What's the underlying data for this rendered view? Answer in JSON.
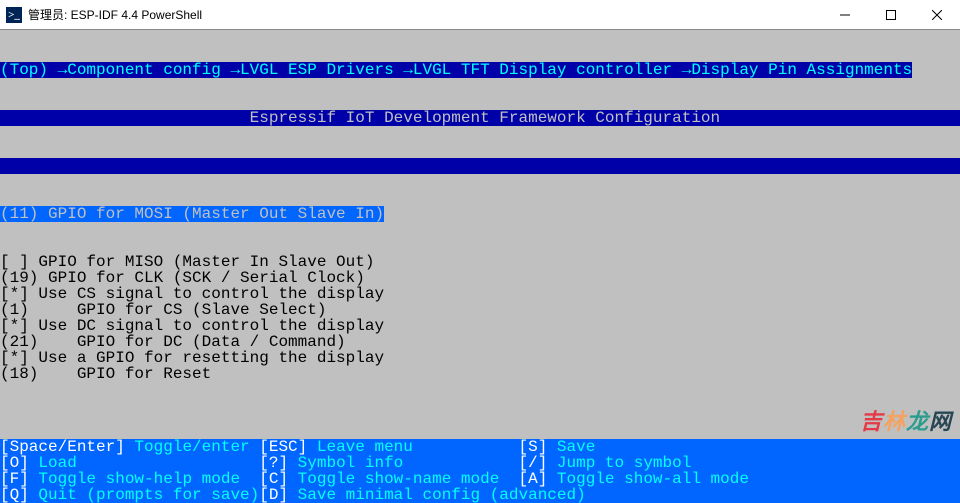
{
  "window": {
    "title": "管理员: ESP-IDF 4.4 PowerShell",
    "icon_label": "PS"
  },
  "breadcrumbs": {
    "full": "(Top) →Component config →LVGL ESP Drivers →LVGL TFT Display controller →Display Pin Assignments"
  },
  "header_banner": "                          Espressif IoT Development Framework Configuration                                         ",
  "selected_line": "(11) GPIO for MOSI (Master Out Slave In)",
  "menu_items": [
    "[ ] GPIO for MISO (Master In Slave Out)",
    "(19) GPIO for CLK (SCK / Serial Clock)",
    "[*] Use CS signal to control the display",
    "(1)     GPIO for CS (Slave Select)",
    "[*] Use DC signal to control the display",
    "(21)    GPIO for DC (Data / Command)",
    "[*] Use a GPIO for resetting the display",
    "(18)    GPIO for Reset"
  ],
  "footer": [
    [
      {
        "key": "[Space/Enter]",
        "label": " Toggle/enter",
        "pad": 23
      },
      {
        "key": "[ESC]",
        "label": " Leave menu",
        "pad": 23
      },
      {
        "key": "[S]",
        "label": " Save",
        "pad": 0
      }
    ],
    [
      {
        "key": "[O]",
        "label": " Load",
        "pad": 23
      },
      {
        "key": "[?]",
        "label": " Symbol info",
        "pad": 23
      },
      {
        "key": "[/]",
        "label": " Jump to symbol",
        "pad": 0
      }
    ],
    [
      {
        "key": "[F]",
        "label": " Toggle show-help mode",
        "pad": 23
      },
      {
        "key": "[C]",
        "label": " Toggle show-name mode",
        "pad": 23
      },
      {
        "key": "[A]",
        "label": " Toggle show-all mode",
        "pad": 0
      }
    ],
    [
      {
        "key": "[Q]",
        "label": " Quit (prompts for save)",
        "pad": 23
      },
      {
        "key": "[D]",
        "label": " Save minimal config (advanced)",
        "pad": 0
      }
    ]
  ],
  "watermark": {
    "a": "吉",
    "b": "林",
    "c": "龙",
    "d": "网"
  }
}
